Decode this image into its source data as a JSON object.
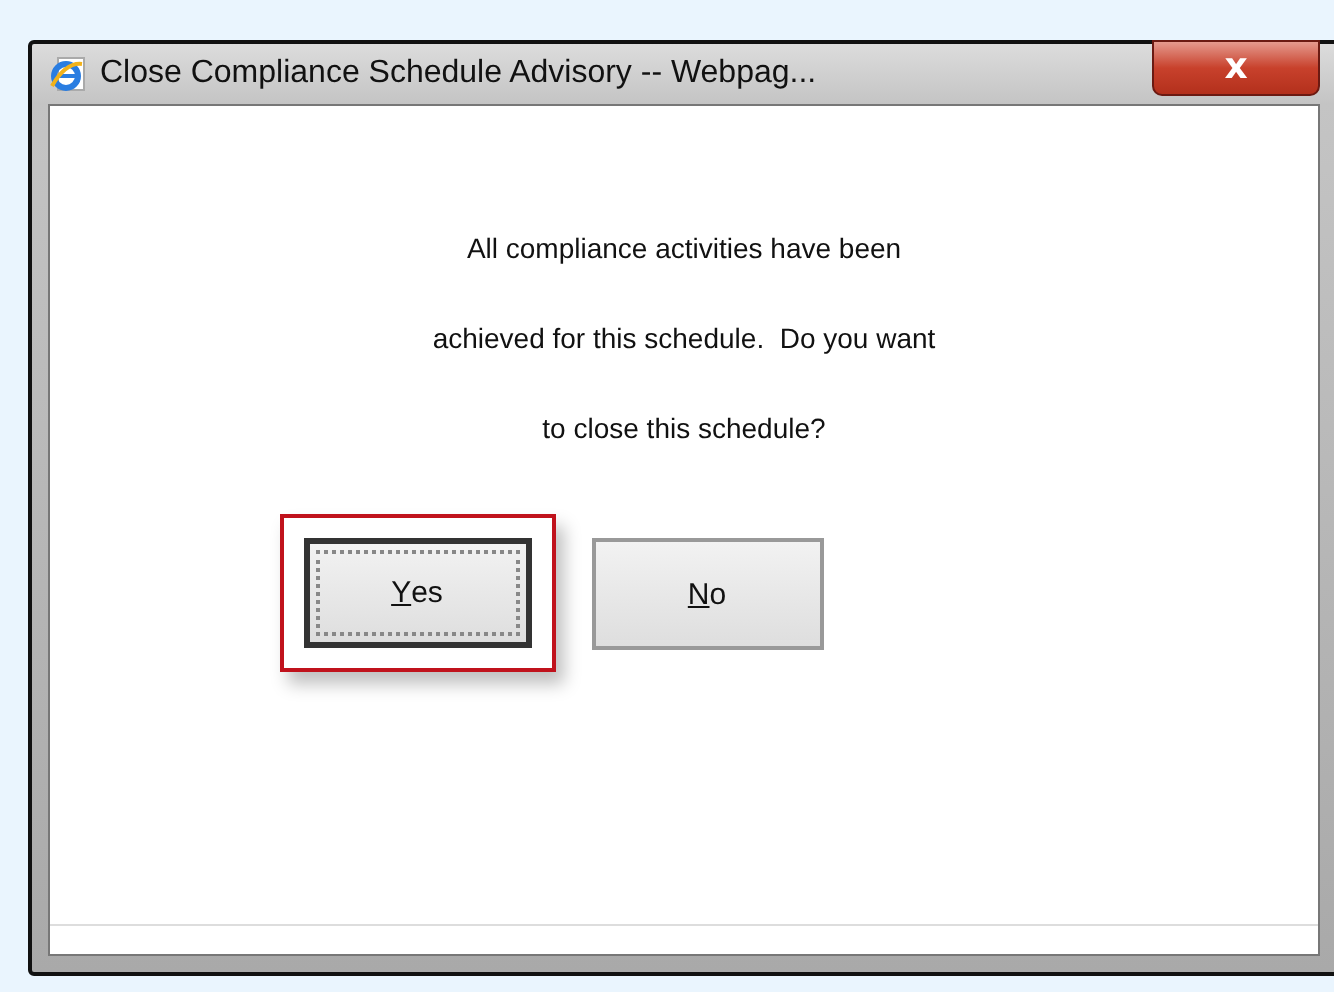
{
  "window": {
    "title": "Close Compliance Schedule Advisory -- Webpag...",
    "close_glyph": "x"
  },
  "message": [
    "All compliance activities have been",
    "achieved for this schedule.  Do you want",
    "to close this schedule?"
  ],
  "buttons": [
    {
      "access_key": "Y",
      "rest": "es",
      "focused": true,
      "highlighted": true
    },
    {
      "access_key": "N",
      "rest": "o",
      "focused": false,
      "highlighted": false
    }
  ]
}
